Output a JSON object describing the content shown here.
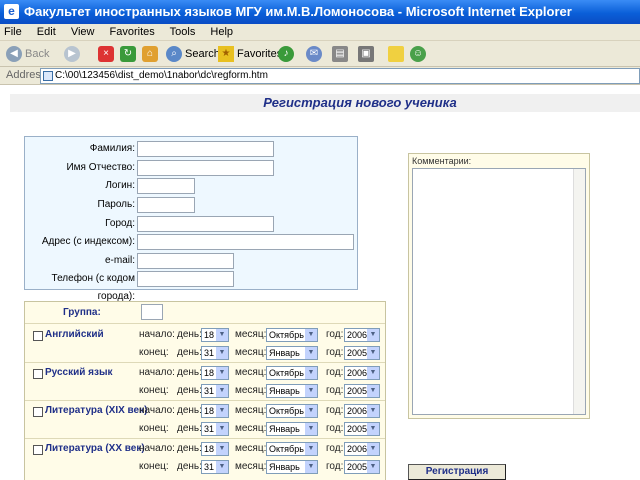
{
  "window": {
    "title": "Факультет иностранных языков МГУ им.М.В.Ломоносова - Microsoft Internet Explorer",
    "icon": "ie-icon"
  },
  "menu": [
    "File",
    "Edit",
    "View",
    "Favorites",
    "Tools",
    "Help"
  ],
  "toolbar": {
    "back": "Back",
    "search": "Search",
    "favorites": "Favorites"
  },
  "address": {
    "label": "Address",
    "value": "C:\\00\\123456\\dist_demo\\1nabor\\dc\\regform.htm"
  },
  "page": {
    "heading": "Регистрация нового ученика",
    "fields": [
      {
        "label": "Фамилия:"
      },
      {
        "label": "Имя Отчество:"
      },
      {
        "label": "Логин:"
      },
      {
        "label": "Пароль:"
      },
      {
        "label": "Город:"
      },
      {
        "label": "Адрес (с индексом):"
      },
      {
        "label": "e-mail:"
      },
      {
        "label": "Телефон (с кодом города):"
      }
    ],
    "group_label": "Группа:",
    "comments_label": "Комментарии:",
    "submit_label": "Регистрация",
    "labels": {
      "start": "начало:",
      "end": "конец:",
      "day": "день:",
      "month": "месяц:",
      "year": "год:"
    },
    "courses": [
      {
        "name": "Английский",
        "start": {
          "day": "18",
          "month": "Октябрь",
          "year": "2006"
        },
        "end": {
          "day": "31",
          "month": "Январь",
          "year": "2005"
        }
      },
      {
        "name": "Русский язык",
        "start": {
          "day": "18",
          "month": "Октябрь",
          "year": "2006"
        },
        "end": {
          "day": "31",
          "month": "Январь",
          "year": "2005"
        }
      },
      {
        "name": "Литература (XIX век)",
        "start": {
          "day": "18",
          "month": "Октябрь",
          "year": "2006"
        },
        "end": {
          "day": "31",
          "month": "Январь",
          "year": "2005"
        }
      },
      {
        "name": "Литература (XX век)",
        "start": {
          "day": "18",
          "month": "Октябрь",
          "year": "2006"
        },
        "end": {
          "day": "31",
          "month": "Январь",
          "year": "2005"
        }
      }
    ]
  }
}
